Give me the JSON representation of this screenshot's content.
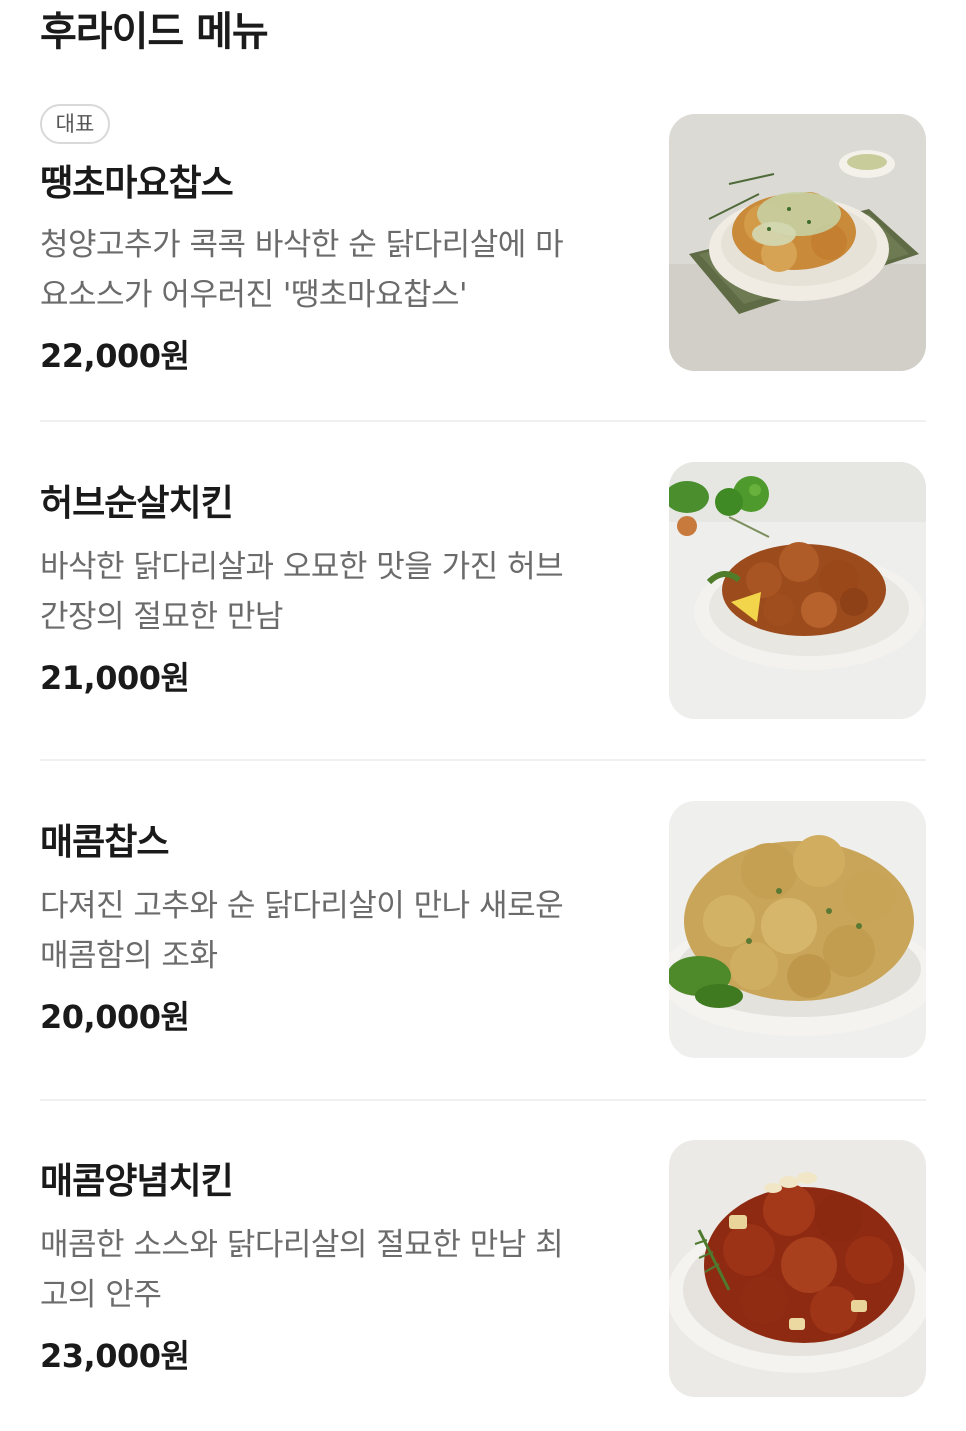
{
  "section": {
    "title": "후라이드 메뉴"
  },
  "items": [
    {
      "badge": "대표",
      "name": "땡초마요찹스",
      "desc_lines": [
        "청양고추가 콕콕 바삭한 순 닭다리살에 마",
        "요소스가 어우러진 '땡초마요찹스'"
      ],
      "price": "22,000원",
      "image_icon": "chicken-mayo-photo"
    },
    {
      "badge": "",
      "name": "허브순살치킨",
      "desc_lines": [
        "바삭한 닭다리살과 오묘한 맛을 가진 허브",
        "간장의 절묘한 만남"
      ],
      "price": "21,000원",
      "image_icon": "herb-chicken-photo"
    },
    {
      "badge": "",
      "name": "매콤찹스",
      "desc_lines": [
        "다져진 고추와 순 닭다리살이 만나 새로운",
        "매콤함의 조화"
      ],
      "price": "20,000원",
      "image_icon": "spicy-chops-photo"
    },
    {
      "badge": "",
      "name": "매콤양념치킨",
      "desc_lines": [
        "매콤한 소스와 닭다리살의 절묘한 만남 최",
        "고의 안주"
      ],
      "price": "23,000원",
      "image_icon": "spicy-yangnyeom-photo"
    }
  ],
  "colors": {
    "text": "#1a1a1a",
    "muted": "#6b6b6b",
    "divider": "#f0f0f0",
    "badge_border": "#d9d9d9"
  }
}
